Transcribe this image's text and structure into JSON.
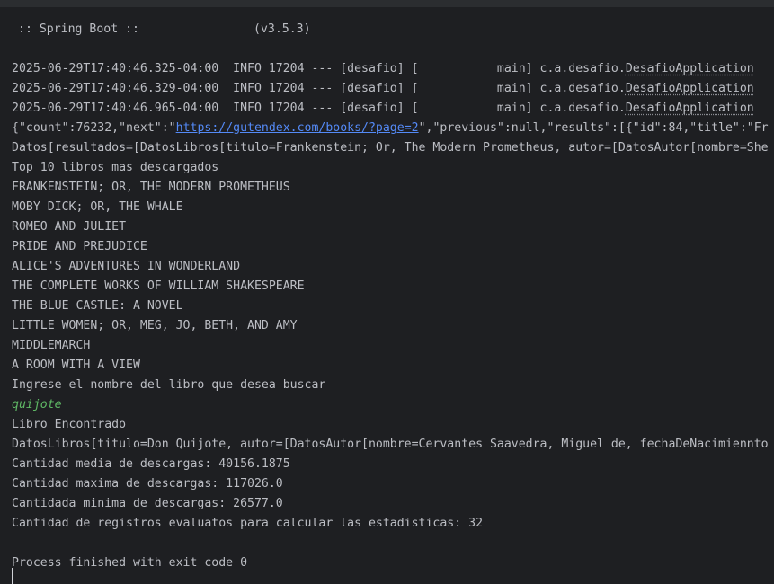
{
  "banner": ":: Spring Boot ::                (v3.5.3)",
  "log_lines": [
    {
      "prefix": "2025-06-29T17:40:46.325-04:00  INFO 17204 --- [desafio] [           main] c.a.desafio.",
      "class_name": "DesafioApplication"
    },
    {
      "prefix": "2025-06-29T17:40:46.329-04:00  INFO 17204 --- [desafio] [           main] c.a.desafio.",
      "class_name": "DesafioApplication"
    },
    {
      "prefix": "2025-06-29T17:40:46.965-04:00  INFO 17204 --- [desafio] [           main] c.a.desafio.",
      "class_name": "DesafioApplication"
    }
  ],
  "json_line": {
    "before": "{\"count\":76232,\"next\":\"",
    "link": "https://gutendex.com/books/?page=2",
    "after": "\",\"previous\":null,\"results\":[{\"id\":84,\"title\":\"Fr"
  },
  "datos_line": "Datos[resultados=[DatosLibros[titulo=Frankenstein; Or, The Modern Prometheus, autor=[DatosAutor[nombre=She",
  "top_title": "Top 10 libros mas descargados",
  "top_books": [
    "FRANKENSTEIN; OR, THE MODERN PROMETHEUS",
    "MOBY DICK; OR, THE WHALE",
    "ROMEO AND JULIET",
    "PRIDE AND PREJUDICE",
    "ALICE'S ADVENTURES IN WONDERLAND",
    "THE COMPLETE WORKS OF WILLIAM SHAKESPEARE",
    "THE BLUE CASTLE: A NOVEL",
    "LITTLE WOMEN; OR, MEG, JO, BETH, AND AMY",
    "MIDDLEMARCH",
    "A ROOM WITH A VIEW"
  ],
  "prompt": "Ingrese el nombre del libro que desea buscar",
  "user_input": "quijote",
  "found": "Libro Encontrado",
  "found_details": "DatosLibros[titulo=Don Quijote, autor=[DatosAutor[nombre=Cervantes Saavedra, Miguel de, fechaDeNacimiennto",
  "stats": [
    "Cantidad media de descargas: 40156.1875",
    "Cantidad maxima de descargas: 117026.0",
    "Cantidada minima de descargas: 26577.0",
    "Cantidad de registros evaluatos para calcular las estadisticas: 32"
  ],
  "exit_message": "Process finished with exit code 0",
  "colors": {
    "background": "#1e1f22",
    "text": "#bcbec4",
    "link": "#548af7",
    "user_input": "#5fb865"
  }
}
